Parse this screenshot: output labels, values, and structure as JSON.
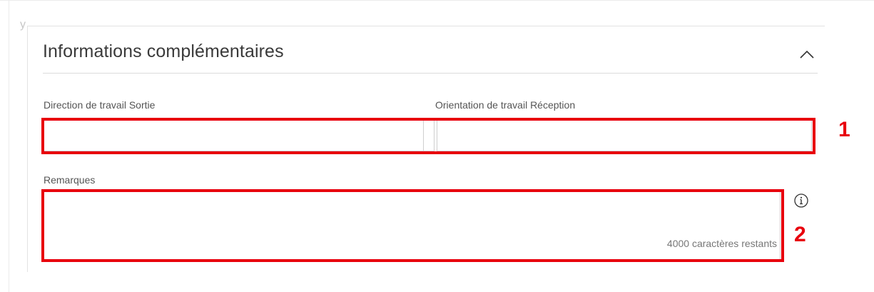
{
  "stray_text": "y",
  "section": {
    "title": "Informations complémentaires",
    "collapse_icon": "chevron-up-icon"
  },
  "fields": {
    "direction_sortie": {
      "label": "Direction de travail Sortie",
      "value": ""
    },
    "orientation_reception": {
      "label": "Orientation de travail Réception",
      "value": ""
    },
    "remarques": {
      "label": "Remarques",
      "value": "",
      "counter": "4000 caractères restants",
      "info_icon": "info-icon"
    }
  },
  "annotations": {
    "callout_1": "1",
    "callout_2": "2",
    "color": "#e8000d"
  }
}
